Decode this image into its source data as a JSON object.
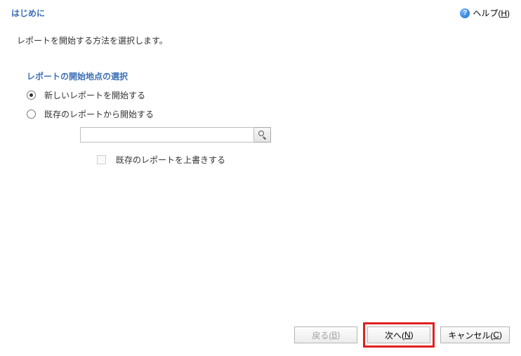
{
  "header": {
    "title": "はじめに",
    "help_label_pre": "ヘルプ(",
    "help_label_u": "H",
    "help_label_post": ")"
  },
  "intro_text": "レポートを開始する方法を選択します。",
  "section": {
    "title": "レポートの開始地点の選択",
    "option_new": "新しいレポートを開始する",
    "option_existing": "既存のレポートから開始する",
    "path_value": "",
    "path_placeholder": "",
    "overwrite_label": "既存のレポートを上書きする"
  },
  "buttons": {
    "back_pre": "戻る(",
    "back_u": "B",
    "back_post": ")",
    "next_pre": "次へ(",
    "next_u": "N",
    "next_post": ")",
    "cancel_pre": "キャンセル(",
    "cancel_u": "C",
    "cancel_post": ")"
  }
}
